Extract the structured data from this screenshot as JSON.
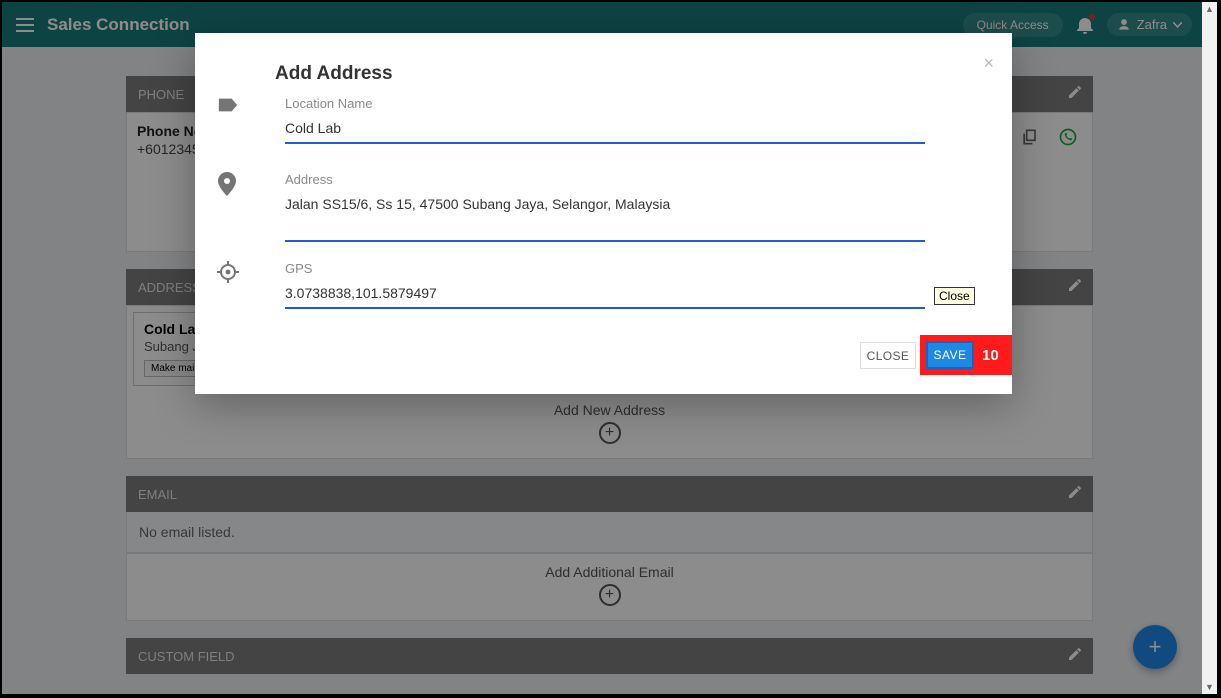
{
  "header": {
    "brand": "Sales Connection",
    "quick_access": "Quick Access",
    "user_name": "Zafra"
  },
  "sections": {
    "phone": {
      "title": "PHONE",
      "label": "Phone No",
      "value": "+6012345"
    },
    "address": {
      "title": "ADDRESS",
      "card_title": "Cold Lab",
      "card_sub": "Subang Ja",
      "card_btn": "Make main a",
      "add_label": "Add New Address"
    },
    "email": {
      "title": "EMAIL",
      "empty": "No email listed.",
      "add_label": "Add Additional Email"
    },
    "custom": {
      "title": "CUSTOM FIELD"
    }
  },
  "modal": {
    "title": "Add Address",
    "location_label": "Location Name",
    "location_value": "Cold Lab",
    "address_label": "Address",
    "address_value": "Jalan SS15/6, Ss 15, 47500 Subang Jaya, Selangor, Malaysia",
    "gps_label": "GPS",
    "gps_value": "3.0738838,101.5879497",
    "close_btn": "CLOSE",
    "save_btn": "SAVE",
    "tooltip": "Close",
    "callout": "10"
  }
}
